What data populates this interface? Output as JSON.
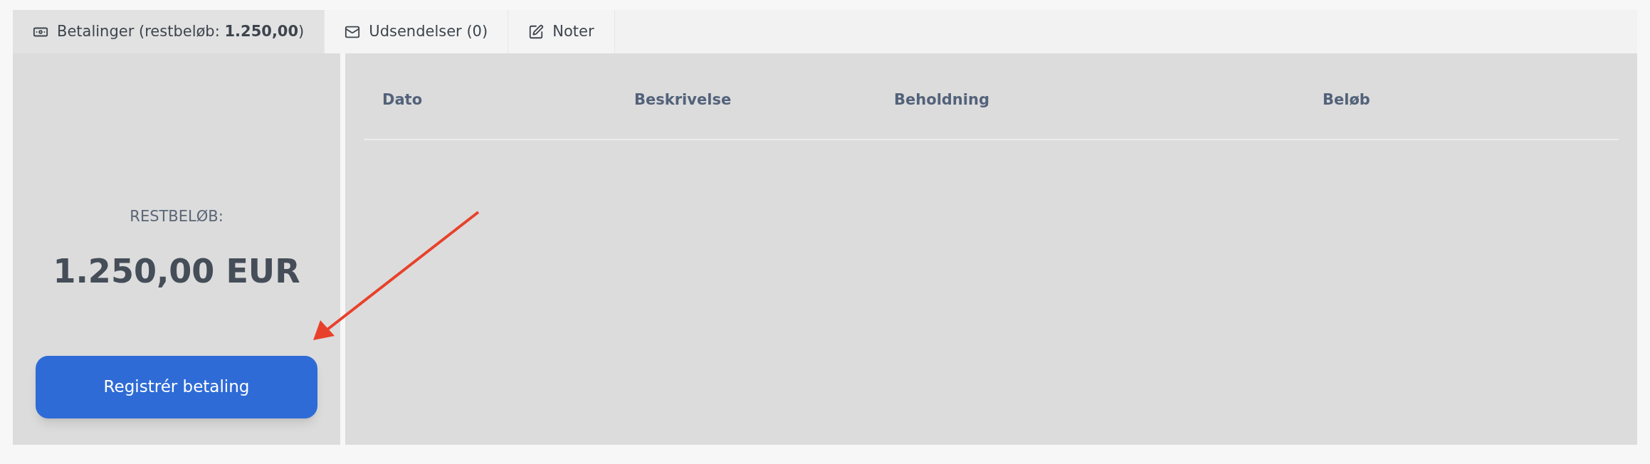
{
  "tabs": [
    {
      "label": "Betalinger (restbeløb: **1.250,00**)",
      "kind": "money",
      "selected": true
    },
    {
      "label": "Udsendelser (0)",
      "kind": "mail",
      "selected": false
    },
    {
      "label": "Noter",
      "kind": "note",
      "selected": false
    }
  ],
  "summary": {
    "label": "RESTBELØB:",
    "amount": "1.250,00 EUR",
    "button": "Registrér betaling"
  },
  "table": {
    "columns": [
      "Dato",
      "Beskrivelse",
      "Beholdning",
      "Beløb"
    ]
  }
}
